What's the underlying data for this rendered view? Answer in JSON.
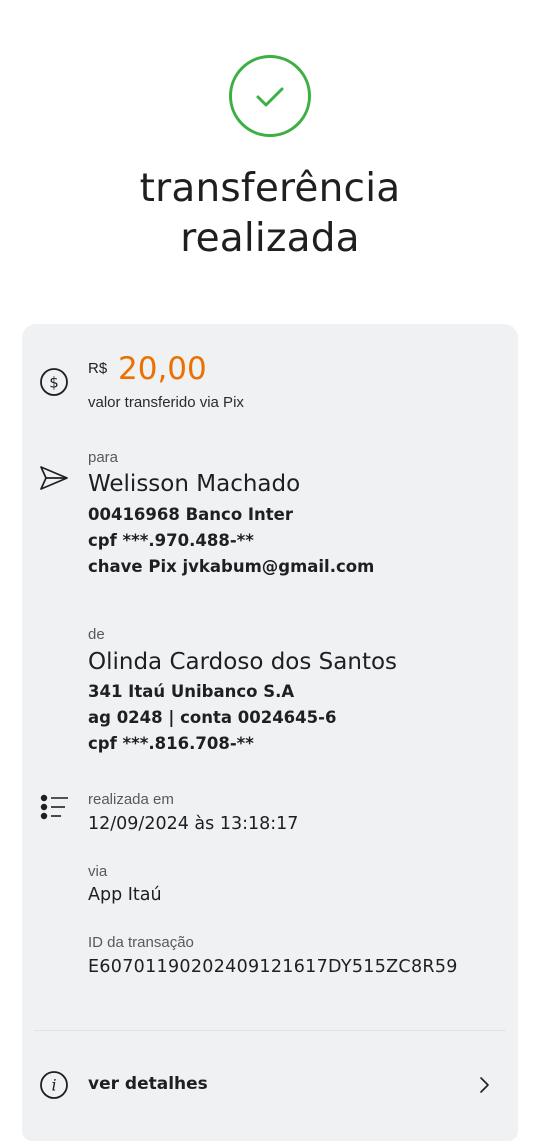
{
  "header": {
    "title_line1": "transferência",
    "title_line2": "realizada"
  },
  "amount": {
    "currency": "R$",
    "value": "20,00",
    "description": "valor transferido via Pix"
  },
  "recipient": {
    "label": "para",
    "name": "Welisson Machado",
    "bank": "00416968 Banco Inter",
    "cpf": "cpf ***.970.488-**",
    "pix_key": "chave Pix jvkabum@gmail.com"
  },
  "sender": {
    "label": "de",
    "name": "Olinda Cardoso dos Santos",
    "bank": "341 Itaú Unibanco S.A",
    "account": "ag 0248 | conta 0024645-6",
    "cpf": "cpf ***.816.708-**"
  },
  "details": {
    "date_label": "realizada em",
    "date_value": "12/09/2024 às 13:18:17",
    "channel_label": "via",
    "channel_value": "App Itaú",
    "transaction_id_label": "ID da transação",
    "transaction_id_value": "E60701190202409121617DY515ZC8R59"
  },
  "footer": {
    "details_link": "ver detalhes"
  },
  "icons": {
    "success": "check-circle-icon",
    "amount": "dollar-circle-icon",
    "recipient": "send-icon",
    "details": "list-icon",
    "info": "info-icon",
    "chevron": "chevron-right-icon"
  },
  "colors": {
    "success_green": "#3cb043",
    "amount_orange": "#ec7000",
    "card_background": "#eff1f3"
  }
}
